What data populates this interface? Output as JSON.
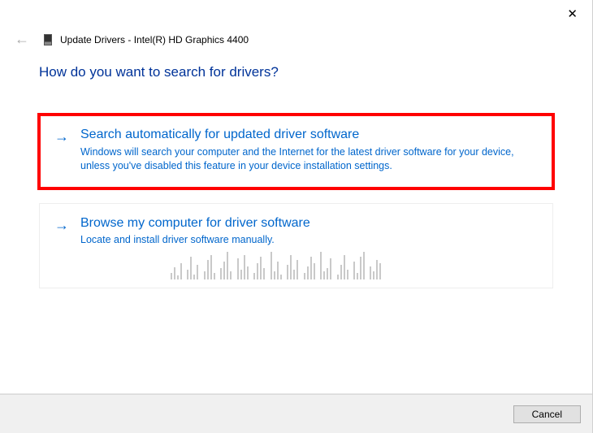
{
  "close_label": "✕",
  "header": {
    "back_glyph": "←",
    "title": "Update Drivers - Intel(R) HD Graphics 4400"
  },
  "question": "How do you want to search for drivers?",
  "options": [
    {
      "arrow": "→",
      "title": "Search automatically for updated driver software",
      "desc": "Windows will search your computer and the Internet for the latest driver software for your device, unless you've disabled this feature in your device installation settings."
    },
    {
      "arrow": "→",
      "title": "Browse my computer for driver software",
      "desc": "Locate and install driver software manually."
    }
  ],
  "footer": {
    "cancel": "Cancel"
  }
}
